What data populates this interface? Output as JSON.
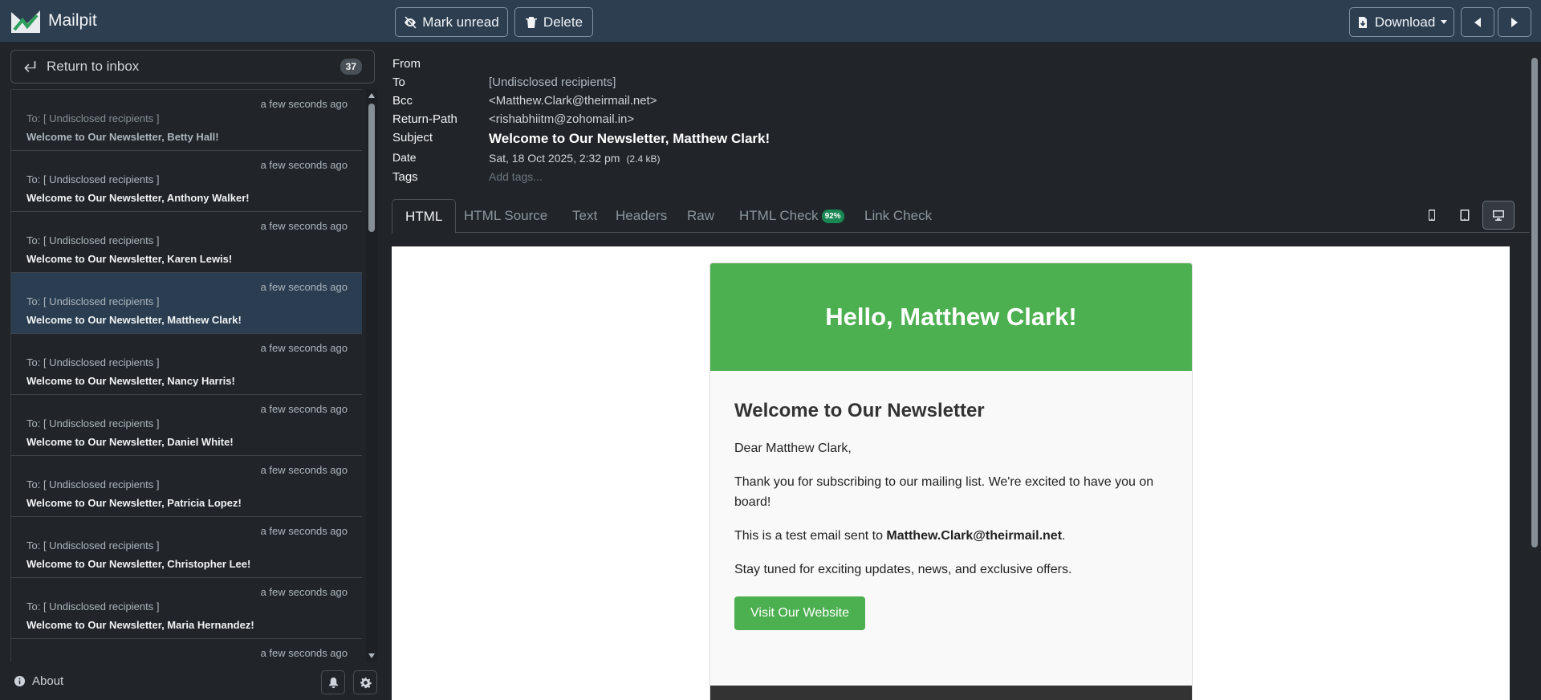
{
  "app": {
    "name": "Mailpit"
  },
  "toolbar": {
    "mark_unread": "Mark unread",
    "delete": "Delete",
    "download": "Download"
  },
  "sidebar": {
    "return_label": "Return to inbox",
    "unread_count": "37",
    "about": "About",
    "messages": [
      {
        "time": "a few seconds ago",
        "to": "To: [ Undisclosed recipients ]",
        "subject": "Welcome to Our Newsletter, Betty Hall!",
        "read": true
      },
      {
        "time": "a few seconds ago",
        "to": "To: [ Undisclosed recipients ]",
        "subject": "Welcome to Our Newsletter, Anthony Walker!"
      },
      {
        "time": "a few seconds ago",
        "to": "To: [ Undisclosed recipients ]",
        "subject": "Welcome to Our Newsletter, Karen Lewis!"
      },
      {
        "time": "a few seconds ago",
        "to": "To: [ Undisclosed recipients ]",
        "subject": "Welcome to Our Newsletter, Matthew Clark!",
        "selected": true
      },
      {
        "time": "a few seconds ago",
        "to": "To: [ Undisclosed recipients ]",
        "subject": "Welcome to Our Newsletter, Nancy Harris!"
      },
      {
        "time": "a few seconds ago",
        "to": "To: [ Undisclosed recipients ]",
        "subject": "Welcome to Our Newsletter, Daniel White!"
      },
      {
        "time": "a few seconds ago",
        "to": "To: [ Undisclosed recipients ]",
        "subject": "Welcome to Our Newsletter, Patricia Lopez!"
      },
      {
        "time": "a few seconds ago",
        "to": "To: [ Undisclosed recipients ]",
        "subject": "Welcome to Our Newsletter, Christopher Lee!"
      },
      {
        "time": "a few seconds ago",
        "to": "To: [ Undisclosed recipients ]",
        "subject": "Welcome to Our Newsletter, Maria Hernandez!"
      },
      {
        "time": "a few seconds ago",
        "to": "",
        "subject": ""
      }
    ]
  },
  "headers": {
    "from_label": "From",
    "from": "",
    "to_label": "To",
    "to": "[Undisclosed recipients]",
    "bcc_label": "Bcc",
    "bcc": "<Matthew.Clark@theirmail.net>",
    "return_path_label": "Return-Path",
    "return_path": "<rishabhiitm@zohomail.in>",
    "subject_label": "Subject",
    "subject": "Welcome to Our Newsletter, Matthew Clark!",
    "date_label": "Date",
    "date": "Sat, 18 Oct 2025, 2:32 pm",
    "size": "(2.4 kB)",
    "tags_label": "Tags",
    "tags_placeholder": "Add tags..."
  },
  "tabs": {
    "html": "HTML",
    "html_source": "HTML Source",
    "text": "Text",
    "headers": "Headers",
    "raw": "Raw",
    "html_check": "HTML Check",
    "html_check_score": "92%",
    "link_check": "Link Check"
  },
  "email": {
    "heading": "Hello, Matthew Clark!",
    "title": "Welcome to Our Newsletter",
    "greeting": "Dear Matthew Clark,",
    "para1": "Thank you for subscribing to our mailing list. We're excited to have you on board!",
    "para2_pre": "This is a test email sent to ",
    "para2_email": "Matthew.Clark@theirmail.net",
    "para2_post": ".",
    "para3": "Stay tuned for exciting updates, news, and exclusive offers.",
    "cta": "Visit Our Website"
  },
  "colors": {
    "navbar": "#2c3e50",
    "background": "#212529",
    "email_green": "#4caf50",
    "badge_green": "#198754",
    "selected_row": "#2b3e51"
  }
}
